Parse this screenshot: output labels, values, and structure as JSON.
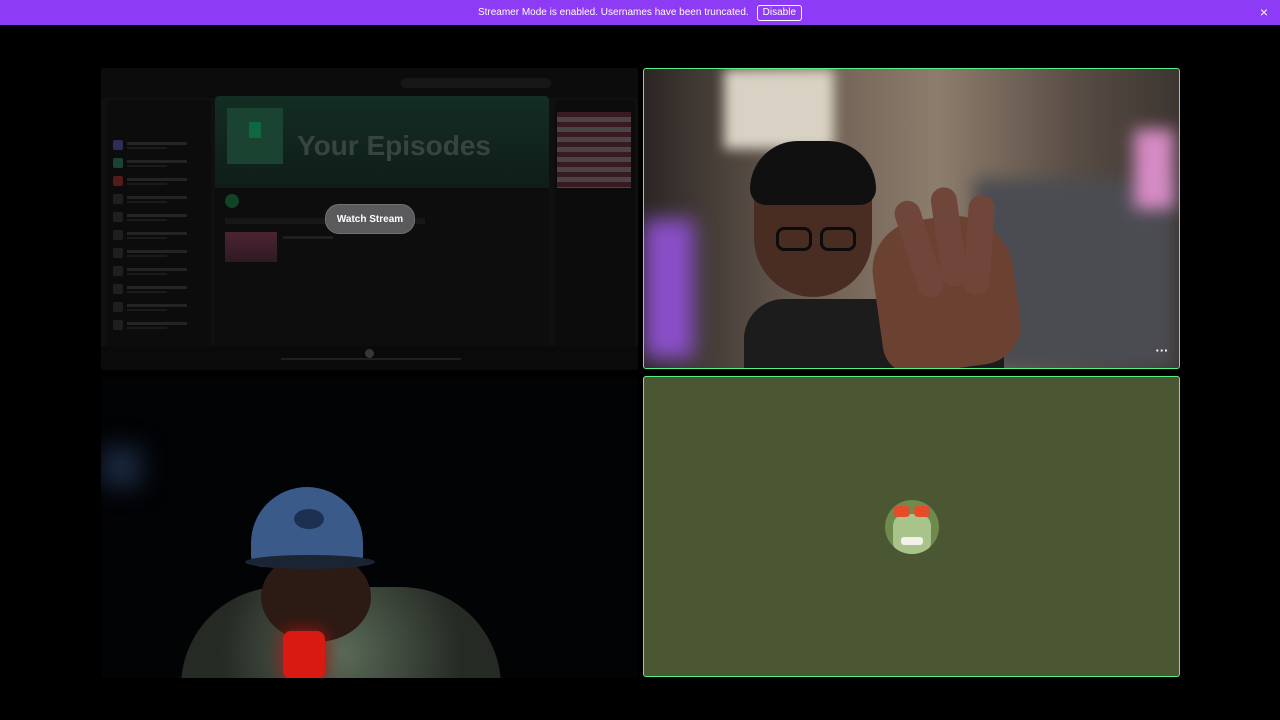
{
  "banner": {
    "text": "Streamer Mode is enabled. Usernames have been truncated.",
    "disable_label": "Disable",
    "close_icon": "×",
    "color": "#8e3bf5"
  },
  "stream_tile": {
    "watch_label": "Watch Stream",
    "preview_title": "Your Episodes"
  },
  "webcam_tile": {
    "more_icon": "···"
  },
  "accent": {
    "speaking_border": "#57f287",
    "avatar_tile_bg": "#4b5632"
  }
}
